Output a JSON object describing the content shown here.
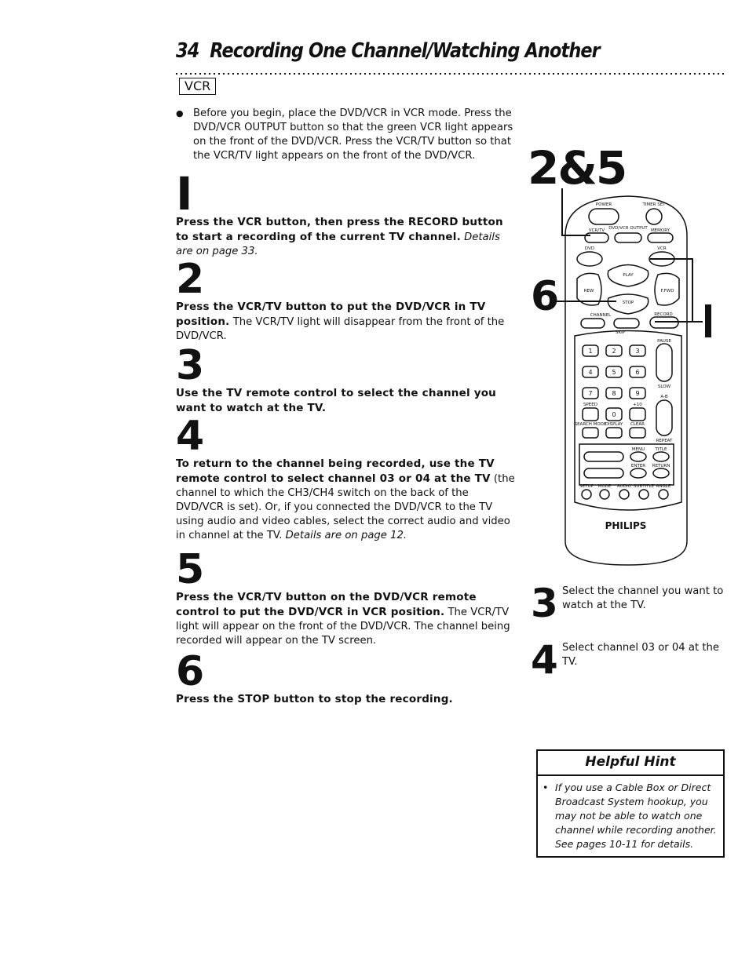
{
  "header": {
    "page_number": "34",
    "title": "Recording One Channel/Watching Another",
    "mode_tag": "VCR"
  },
  "intro": {
    "bullet": "●",
    "text": "Before you begin, place the DVD/VCR in VCR mode. Press the DVD/VCR OUTPUT button so that the green VCR light appears on the front of the DVD/VCR. Press the VCR/TV button so that the VCR/TV light appears on the front of the DVD/VCR."
  },
  "steps": [
    {
      "number": "1",
      "bold": "Press the VCR button, then press the RECORD button to start a recording of the current TV channel.",
      "normal": "",
      "italic": " Details are on page 33."
    },
    {
      "number": "2",
      "bold": "Press the VCR/TV button to put the DVD/VCR in TV position.",
      "normal": " The VCR/TV light will disappear from the front of the DVD/VCR.",
      "italic": ""
    },
    {
      "number": "3",
      "bold": "Use the TV remote control to select the channel you want to watch at the TV.",
      "normal": "",
      "italic": ""
    },
    {
      "number": "4",
      "bold": "To return to the channel being recorded, use the TV remote control to select channel 03 or 04 at the TV",
      "normal": " (the channel to which the CH3/CH4 switch on the back of the DVD/VCR is set). Or, if you connected the DVD/VCR to the TV using audio and video cables, select the correct audio and video in channel at the TV.",
      "italic": " Details are on page 12."
    },
    {
      "number": "5",
      "bold": "Press the VCR/TV button on the DVD/VCR remote control to put the DVD/VCR in VCR position.",
      "normal": " The VCR/TV light will appear on the front of the DVD/VCR. The channel being recorded will appear on the TV screen.",
      "italic": ""
    },
    {
      "number": "6",
      "bold": "Press the STOP button to stop the recording.",
      "normal": "",
      "italic": ""
    }
  ],
  "remote": {
    "callout_top": "2&5",
    "callout_left": "6",
    "callout_right": "1",
    "brand": "PHILIPS",
    "labels": {
      "power": "POWER",
      "timer_set": "TIMER SET",
      "vcr_tv": "VCR/TV",
      "dvd_vcr_output": "DVD/VCR OUTPUT",
      "memory": "MEMORY",
      "dvd": "DVD",
      "vcr": "VCR",
      "play": "PLAY",
      "rew": "REW",
      "ffwd": "F.FWD",
      "stop": "STOP",
      "channel": "CHANNEL",
      "skip": "SKIP",
      "record": "RECORD",
      "pause": "PAUSE",
      "slow": "SLOW",
      "speed": "SPEED",
      "plus10": "+10",
      "ab": "A-B",
      "repeat": "REPEAT",
      "search_mode": "SEARCH MODE",
      "display": "DISPLAY",
      "clear": "CLEAR",
      "menu": "MENU",
      "title": "TITLE",
      "enter": "ENTER",
      "return": "RETURN",
      "setup": "SETUP",
      "mode": "MODE",
      "audio": "AUDIO",
      "subtitle": "SUBTITLE",
      "angle": "ANGLE"
    },
    "digits": [
      "1",
      "2",
      "3",
      "4",
      "5",
      "6",
      "7",
      "8",
      "9",
      "0"
    ]
  },
  "side_steps": [
    {
      "number": "3",
      "text": "Select the channel you want to watch at the TV."
    },
    {
      "number": "4",
      "text": "Select channel 03 or 04 at the TV."
    }
  ],
  "hint": {
    "title": "Helpful Hint",
    "bullet": "•",
    "text": "If you use a Cable Box or Direct Broadcast System hookup, you may not be able to watch one channel while recording another. See pages 10-11 for details."
  }
}
